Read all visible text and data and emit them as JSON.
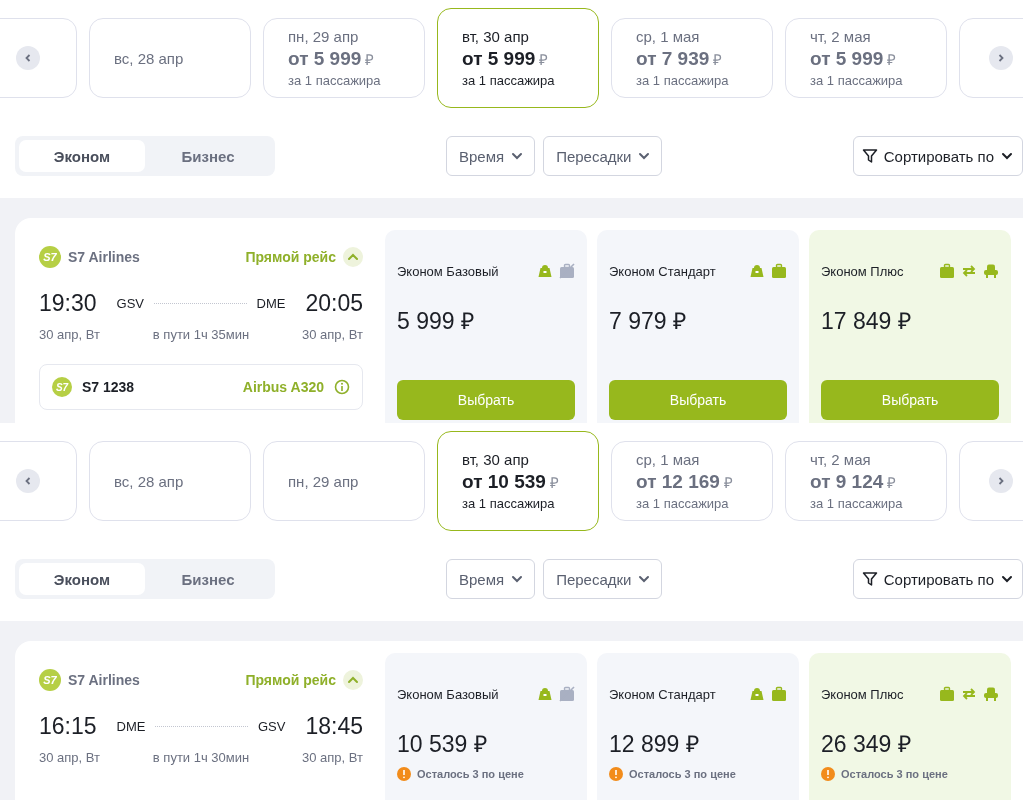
{
  "panels": [
    {
      "date_strip": {
        "dates": [
          {
            "label": "вс, 28 апр",
            "selected": false
          },
          {
            "label": "пн, 29 апр",
            "price": "от 5 999",
            "currency": "₽",
            "note": "за 1 пассажира",
            "selected": false
          },
          {
            "label": "вт, 30 апр",
            "price": "от 5 999",
            "currency": "₽",
            "note": "за 1 пассажира",
            "selected": true
          },
          {
            "label": "ср, 1 мая",
            "price": "от 7 939",
            "currency": "₽",
            "note": "за 1 пассажира",
            "selected": false
          },
          {
            "label": "чт, 2 мая",
            "price": "от 5 999",
            "currency": "₽",
            "note": "за 1 пассажира",
            "selected": false
          }
        ]
      },
      "cabin_tabs": [
        {
          "label": "Эконом",
          "selected": true
        },
        {
          "label": "Бизнес",
          "selected": false
        }
      ],
      "filters": [
        {
          "label": "Время"
        },
        {
          "label": "Пересадки"
        }
      ],
      "sort": {
        "label": "Сортировать по"
      },
      "flight": {
        "airline": {
          "logo": "S7",
          "name": "S7 Airlines"
        },
        "direct_label": "Прямой рейс",
        "expanded": true,
        "departure": {
          "time": "19:30",
          "code": "GSV",
          "date": "30 апр, Вт"
        },
        "arrival": {
          "time": "20:05",
          "code": "DME",
          "date": "30 апр, Вт"
        },
        "duration": "в пути 1ч 35мин",
        "segment": {
          "logo": "S7",
          "number": "S7 1238",
          "aircraft": "Airbus A320"
        },
        "fares": [
          {
            "name": "Эконом Базовый",
            "price": "5 999 ₽",
            "highlighted": false,
            "amenities": [
              {
                "kind": "cabin_bag",
                "included": true
              },
              {
                "kind": "baggage",
                "included": false
              }
            ],
            "button": "Выбрать"
          },
          {
            "name": "Эконом Стандарт",
            "price": "7 979 ₽",
            "highlighted": false,
            "amenities": [
              {
                "kind": "cabin_bag",
                "included": true
              },
              {
                "kind": "baggage",
                "included": true
              }
            ],
            "button": "Выбрать"
          },
          {
            "name": "Эконом Плюс",
            "price": "17 849 ₽",
            "highlighted": true,
            "amenities": [
              {
                "kind": "baggage",
                "included": true
              },
              {
                "kind": "exchange",
                "included": true
              },
              {
                "kind": "seat",
                "included": true
              }
            ],
            "button": "Выбрать"
          }
        ]
      }
    },
    {
      "date_strip": {
        "dates": [
          {
            "label": "вс, 28 апр",
            "selected": false
          },
          {
            "label": "пн, 29 апр",
            "selected": false
          },
          {
            "label": "вт, 30 апр",
            "price": "от 10 539",
            "currency": "₽",
            "note": "за 1 пассажира",
            "selected": true
          },
          {
            "label": "ср, 1 мая",
            "price": "от 12 169",
            "currency": "₽",
            "note": "за 1 пассажира",
            "selected": false
          },
          {
            "label": "чт, 2 мая",
            "price": "от 9 124",
            "currency": "₽",
            "note": "за 1 пассажира",
            "selected": false
          }
        ]
      },
      "cabin_tabs": [
        {
          "label": "Эконом",
          "selected": true
        },
        {
          "label": "Бизнес",
          "selected": false
        }
      ],
      "filters": [
        {
          "label": "Время"
        },
        {
          "label": "Пересадки"
        }
      ],
      "sort": {
        "label": "Сортировать по"
      },
      "flight": {
        "airline": {
          "logo": "S7",
          "name": "S7 Airlines"
        },
        "direct_label": "Прямой рейс",
        "expanded": true,
        "departure": {
          "time": "16:15",
          "code": "DME",
          "date": "30 апр, Вт"
        },
        "arrival": {
          "time": "18:45",
          "code": "GSV",
          "date": "30 апр, Вт"
        },
        "duration": "в пути 1ч 30мин",
        "fares": [
          {
            "name": "Эконом Базовый",
            "price": "10 539 ₽",
            "highlighted": false,
            "amenities": [
              {
                "kind": "cabin_bag",
                "included": true
              },
              {
                "kind": "baggage",
                "included": false
              }
            ],
            "note": "Осталось 3 по цене"
          },
          {
            "name": "Эконом Стандарт",
            "price": "12 899 ₽",
            "highlighted": false,
            "amenities": [
              {
                "kind": "cabin_bag",
                "included": true
              },
              {
                "kind": "baggage",
                "included": true
              }
            ],
            "note": "Осталось 3 по цене"
          },
          {
            "name": "Эконом Плюс",
            "price": "26 349 ₽",
            "highlighted": true,
            "amenities": [
              {
                "kind": "baggage",
                "included": true
              },
              {
                "kind": "exchange",
                "included": true
              },
              {
                "kind": "seat",
                "included": true
              }
            ],
            "note": "Осталось 3 по цене"
          }
        ]
      }
    }
  ]
}
